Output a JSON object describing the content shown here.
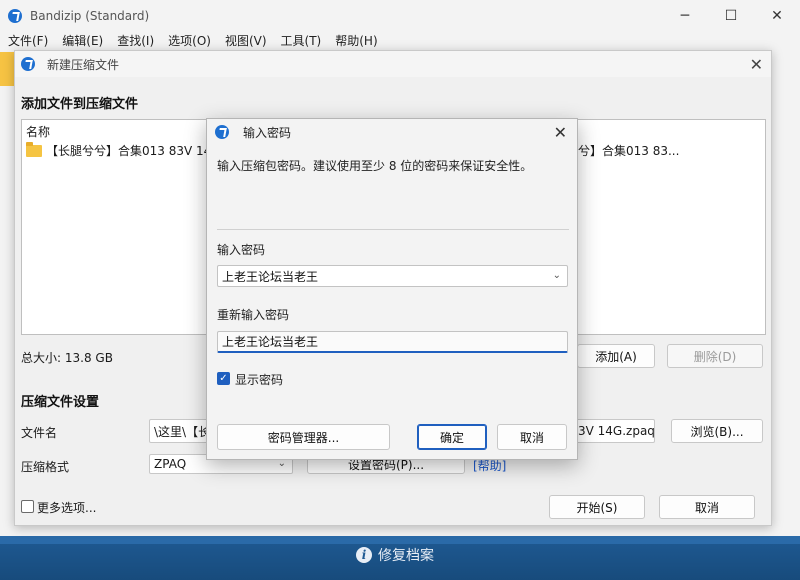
{
  "app": {
    "title": "Bandizip (Standard)",
    "menu": [
      "文件(F)",
      "编辑(E)",
      "查找(I)",
      "选项(O)",
      "视图(V)",
      "工具(T)",
      "帮助(H)"
    ],
    "controls": {
      "minimize": "─",
      "maximize": "☐",
      "close": "✕"
    }
  },
  "new_archive": {
    "title": "新建压缩文件",
    "close": "✕",
    "add_section": "添加文件到压缩文件",
    "list_header": "名称",
    "file_row": "【长腿兮兮】合集013 83V 14",
    "file_row_tail": "兮】合集013 83...",
    "total_size": "总大小: 13.8 GB",
    "add_button": "添加(A)",
    "delete_button": "删除(D)",
    "settings_section": "压缩文件设置",
    "filename_label": "文件名",
    "filename_value": "\\这里\\【长",
    "filename_tail": "3V 14G.zpaq",
    "browse_button": "浏览(B)...",
    "format_label": "压缩格式",
    "format_value": "ZPAQ",
    "set_password_button": "设置密码(P)...",
    "help_link": "[帮助]",
    "more_options": "更多选项...",
    "start_button": "开始(S)",
    "cancel_button": "取消"
  },
  "password_dialog": {
    "title": "输入密码",
    "close": "✕",
    "description": "输入压缩包密码。建议使用至少 8 位的密码来保证安全性。",
    "password_label": "输入密码",
    "password_value": "上老王论坛当老王",
    "reenter_label": "重新输入密码",
    "reenter_value": "上老王论坛当老王",
    "show_password_label": "显示密码",
    "show_password_checked": true,
    "password_manager_button": "密码管理器...",
    "ok_button": "确定",
    "cancel_button": "取消"
  },
  "footer": {
    "repair": "修复档案"
  }
}
